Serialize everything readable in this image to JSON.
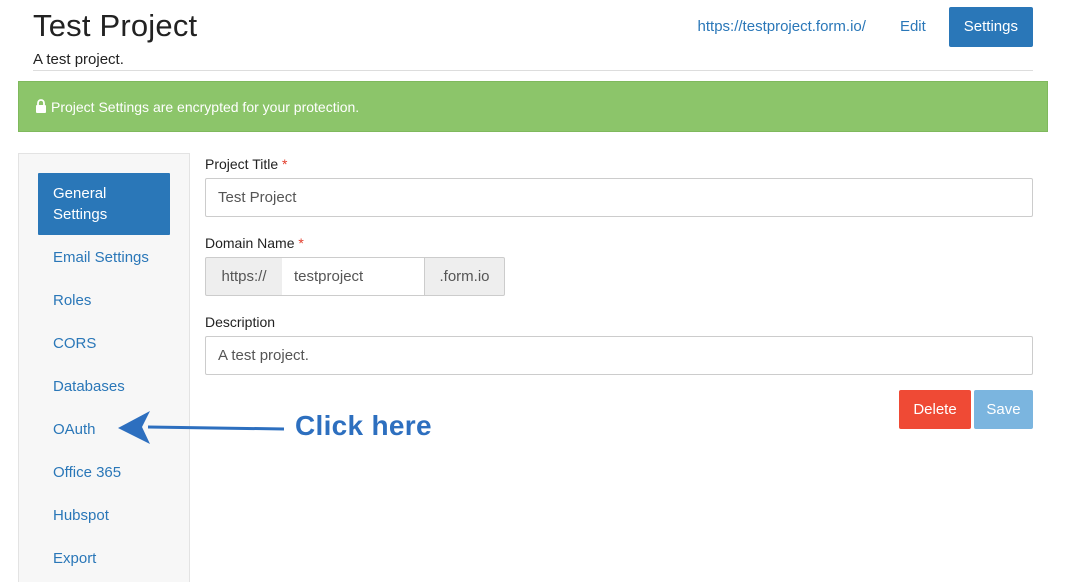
{
  "header": {
    "title": "Test Project",
    "subtitle": "A test project.",
    "nav": {
      "url_link": "https://testproject.form.io/",
      "edit": "Edit",
      "settings": "Settings"
    }
  },
  "alert": {
    "icon": "lock-icon",
    "text": "Project Settings are encrypted for your protection.",
    "color": "#8cc56a"
  },
  "sidebar": {
    "items": [
      {
        "label_line1": "General",
        "label_line2": "Settings",
        "active": true
      },
      {
        "label": "Email Settings"
      },
      {
        "label": "Roles"
      },
      {
        "label": "CORS"
      },
      {
        "label": "Databases"
      },
      {
        "label": "OAuth"
      },
      {
        "label": "Office 365"
      },
      {
        "label": "Hubspot"
      },
      {
        "label": "Export"
      }
    ]
  },
  "form": {
    "project_title": {
      "label": "Project Title",
      "required_mark": "*",
      "value": "Test Project"
    },
    "domain_name": {
      "label": "Domain Name",
      "required_mark": "*",
      "prefix": "https://",
      "value": "testproject",
      "suffix": ".form.io"
    },
    "description": {
      "label": "Description",
      "value": "A test project."
    },
    "delete_label": "Delete",
    "save_label": "Save"
  },
  "annotation": {
    "text": "Click here",
    "color": "#2d6fbf"
  },
  "colors": {
    "primary": "#2a77b8",
    "danger": "#ef4a35",
    "save_disabled": "#7bb5df"
  }
}
